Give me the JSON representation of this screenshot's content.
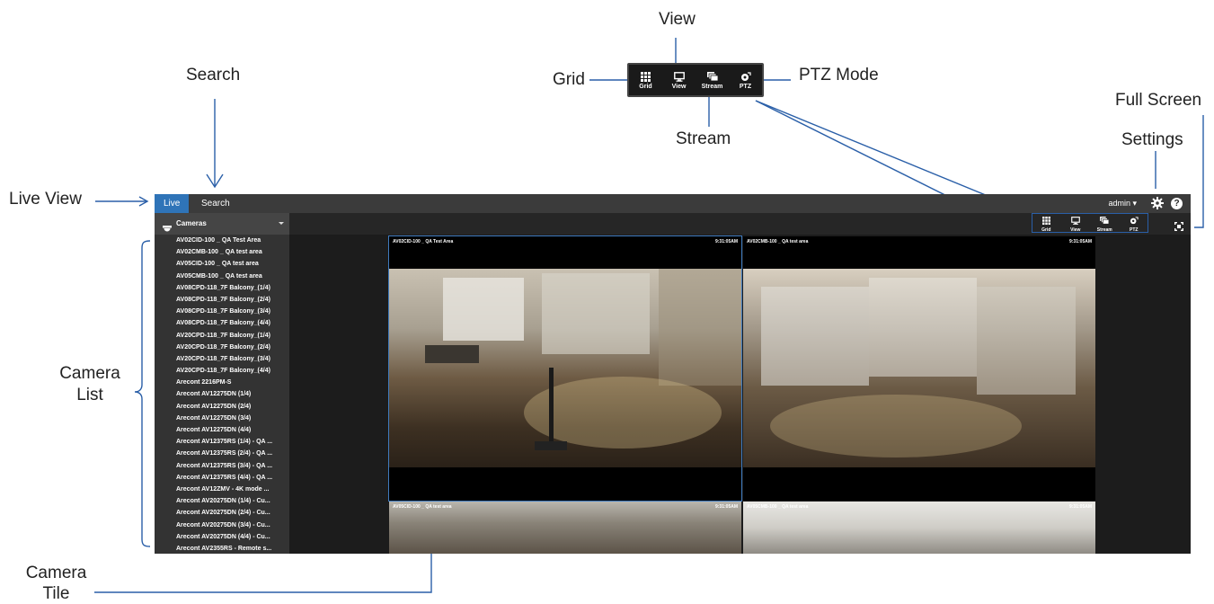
{
  "callouts": {
    "view": "View",
    "search": "Search",
    "grid": "Grid",
    "ptz_mode": "PTZ Mode",
    "full_screen": "Full Screen",
    "stream": "Stream",
    "settings": "Settings",
    "live_view": "Live View",
    "camera_list": [
      "Camera",
      "List"
    ],
    "camera_tile": [
      "Camera",
      "Tile"
    ]
  },
  "toolbar": {
    "grid": "Grid",
    "view": "View",
    "stream": "Stream",
    "ptz": "PTZ"
  },
  "tabs": {
    "live": "Live",
    "search": "Search"
  },
  "user": {
    "name": "admin ▾"
  },
  "camera_panel": {
    "header": "Cameras",
    "items": [
      "AV02CID-100 _ QA Test Area",
      "AV02CMB-100 _ QA test area",
      "AV05CID-100 _ QA test area",
      "AV05CMB-100 _ QA test area",
      "AV08CPD-118_7F Balcony_(1/4)",
      "AV08CPD-118_7F Balcony_(2/4)",
      "AV08CPD-118_7F Balcony_(3/4)",
      "AV08CPD-118_7F Balcony_(4/4)",
      "AV20CPD-118_7F Balcony_(1/4)",
      "AV20CPD-118_7F Balcony_(2/4)",
      "AV20CPD-118_7F Balcony_(3/4)",
      "AV20CPD-118_7F Balcony_(4/4)",
      "Arecont 2216PM-S",
      "Arecont AV12275DN (1/4)",
      "Arecont AV12275DN (2/4)",
      "Arecont AV12275DN (3/4)",
      "Arecont AV12275DN (4/4)",
      "Arecont AV12375RS (1/4) - QA ...",
      "Arecont AV12375RS (2/4) - QA ...",
      "Arecont AV12375RS (3/4) - QA ...",
      "Arecont AV12375RS (4/4) - QA ...",
      "Arecont AV12ZMV - 4K mode ...",
      "Arecont AV20275DN (1/4) - Cu...",
      "Arecont AV20275DN (2/4) - Cu...",
      "Arecont AV20275DN (3/4) - Cu...",
      "Arecont AV20275DN (4/4) - Cu...",
      "Arecont AV2355RS - Remote s..."
    ]
  },
  "tiles": [
    {
      "name": "AV02CID-100 _ QA Test Area",
      "time": "9:31:05AM",
      "selected": true
    },
    {
      "name": "AV02CMB-100 _ QA test area",
      "time": "9:31:05AM",
      "selected": false
    },
    {
      "name": "AV05CID-100 _ QA test area",
      "time": "9:31:05AM",
      "selected": false
    },
    {
      "name": "AV05CMB-100 _ QA test area",
      "time": "9:31:05AM",
      "selected": false
    }
  ],
  "colors": {
    "accent": "#2f74b8",
    "callout_line": "#2a5fa8"
  }
}
